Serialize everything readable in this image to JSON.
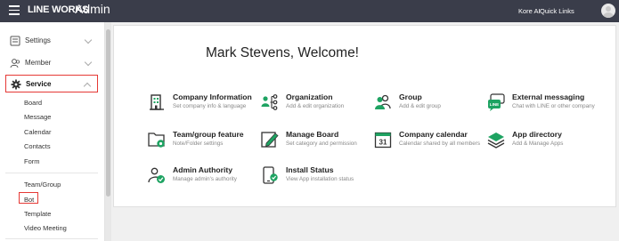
{
  "topbar": {
    "brand": "LINE WORKS",
    "brand_sub": "Admin",
    "user": "Kore AI",
    "quick_links": "Quick Links"
  },
  "sidebar": {
    "settings": "Settings",
    "member": "Member",
    "service": "Service",
    "service_items": [
      "Board",
      "Message",
      "Calendar",
      "Contacts",
      "Form"
    ],
    "other_items": [
      "Team/Group",
      "Bot",
      "Template",
      "Video Meeting"
    ]
  },
  "main": {
    "welcome": "Mark Stevens, Welcome!",
    "cards": [
      {
        "title": "Company Information",
        "desc": "Set company info & language",
        "icon": "building-icon"
      },
      {
        "title": "Organization",
        "desc": "Add & edit organization",
        "icon": "org-chart-icon"
      },
      {
        "title": "Group",
        "desc": "Add & edit group",
        "icon": "group-icon"
      },
      {
        "title": "External messaging",
        "desc": "Chat with LINE or other company",
        "icon": "line-chat-icon"
      },
      {
        "title": "Team/group feature",
        "desc": "Note/Folder settings",
        "icon": "folder-gear-icon"
      },
      {
        "title": "Manage Board",
        "desc": "Set category and permission",
        "icon": "pen-board-icon"
      },
      {
        "title": "Company calendar",
        "desc": "Calendar shared by all members",
        "icon": "calendar-icon"
      },
      {
        "title": "App directory",
        "desc": "Add & Manage Apps",
        "icon": "layers-icon"
      },
      {
        "title": "Admin Authority",
        "desc": "Manage admin's authority",
        "icon": "admin-check-icon"
      },
      {
        "title": "Install Status",
        "desc": "View App installation status",
        "icon": "phone-status-icon"
      }
    ],
    "calendar_day": "31"
  },
  "colors": {
    "topbar": "#3a3d4a",
    "accent_green": "#1ea362",
    "highlight_red": "#e53935"
  }
}
